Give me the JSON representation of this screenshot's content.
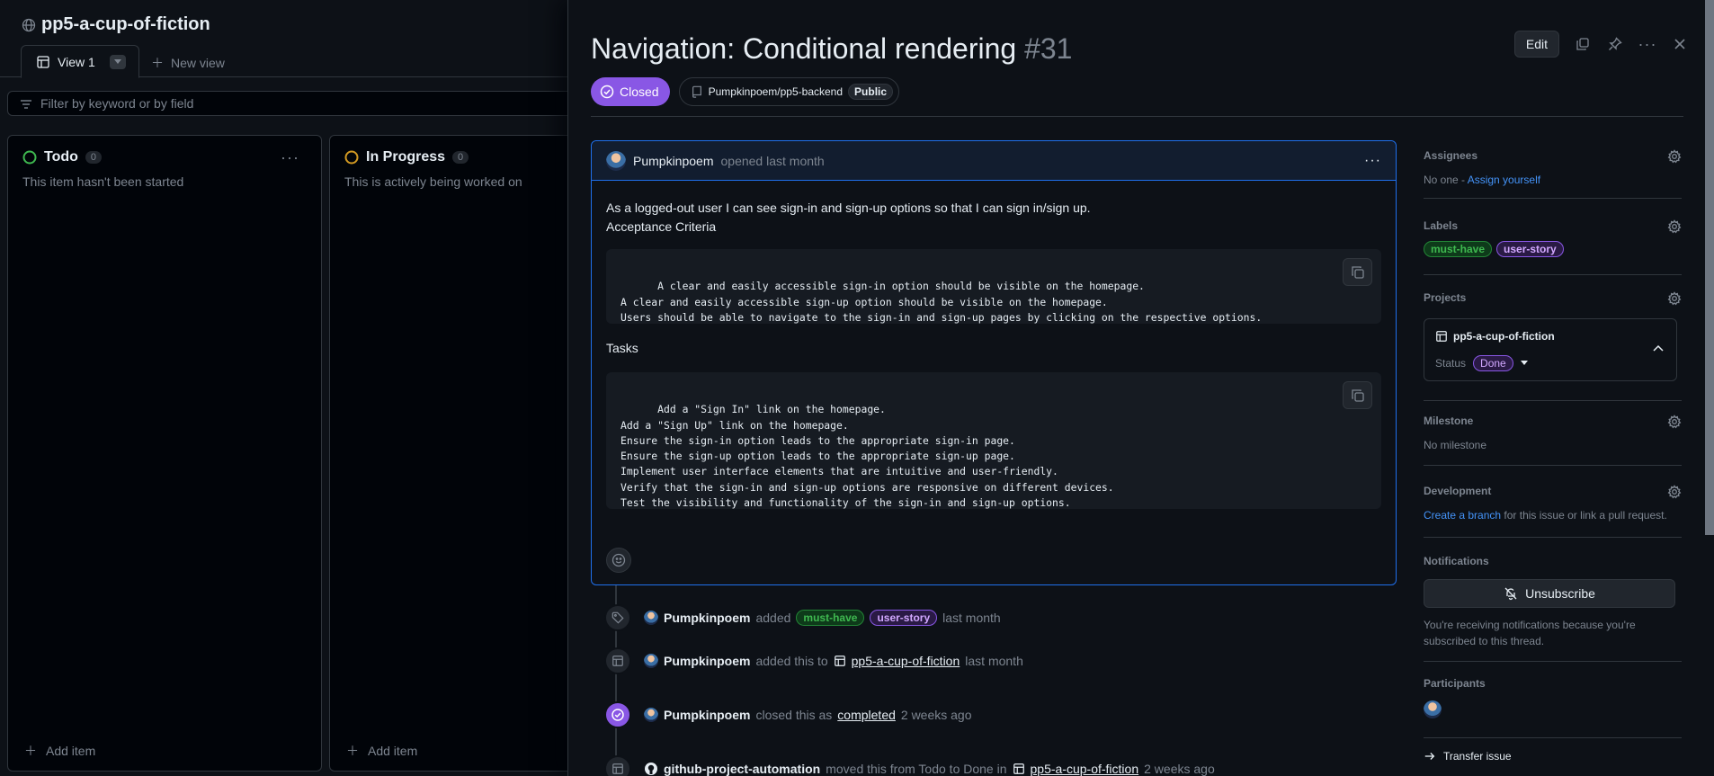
{
  "board": {
    "title": "pp5-a-cup-of-fiction",
    "view_tab": "View 1",
    "new_view": "New view",
    "filter_placeholder": "Filter by keyword or by field",
    "columns": [
      {
        "name": "Todo",
        "count": "0",
        "description": "This item hasn't been started",
        "add": "Add item",
        "status_color": "#3fb950"
      },
      {
        "name": "In Progress",
        "count": "0",
        "description": "This is actively being worked on",
        "add": "Add item",
        "status_color": "#d29922"
      }
    ]
  },
  "issue": {
    "title": "Navigation: Conditional rendering",
    "number": "#31",
    "edit_label": "Edit",
    "state": "Closed",
    "repo": "Pumpkinpoem/pp5-backend",
    "visibility": "Public",
    "comment": {
      "author": "Pumpkinpoem",
      "meta": "opened last month",
      "line1": "As a logged-out user I can see sign-in and sign-up options so that I can sign in/sign up.",
      "line2": "Acceptance Criteria",
      "code1": "A clear and easily accessible sign-in option should be visible on the homepage.\nA clear and easily accessible sign-up option should be visible on the homepage.\nUsers should be able to navigate to the sign-in and sign-up pages by clicking on the respective options.",
      "tasks_heading": "Tasks",
      "code2": "Add a \"Sign In\" link on the homepage.\nAdd a \"Sign Up\" link on the homepage.\nEnsure the sign-in option leads to the appropriate sign-in page.\nEnsure the sign-up option leads to the appropriate sign-up page.\nImplement user interface elements that are intuitive and user-friendly.\nVerify that the sign-in and sign-up options are responsive on different devices.\nTest the visibility and functionality of the sign-in and sign-up options."
    },
    "timeline": [
      {
        "actor": "Pumpkinpoem",
        "action": "added",
        "labels": [
          "must-have",
          "user-story"
        ],
        "time": "last month"
      },
      {
        "actor": "Pumpkinpoem",
        "action": "added this to",
        "project": "pp5-a-cup-of-fiction",
        "time": "last month"
      },
      {
        "actor": "Pumpkinpoem",
        "action": "closed this as",
        "link": "completed",
        "time": "2 weeks ago"
      },
      {
        "actor": "github-project-automation",
        "action": "moved this from Todo to Done in",
        "project": "pp5-a-cup-of-fiction",
        "time": "2 weeks ago"
      }
    ]
  },
  "sidebar": {
    "assignees": {
      "title": "Assignees",
      "value": "No one - ",
      "link": "Assign yourself"
    },
    "labels": {
      "title": "Labels",
      "items": [
        "must-have",
        "user-story"
      ]
    },
    "projects": {
      "title": "Projects",
      "name": "pp5-a-cup-of-fiction",
      "status_label": "Status",
      "status": "Done"
    },
    "milestone": {
      "title": "Milestone",
      "value": "No milestone"
    },
    "development": {
      "title": "Development",
      "link": "Create a branch",
      "rest": " for this issue or link a pull request."
    },
    "notifications": {
      "title": "Notifications",
      "button": "Unsubscribe",
      "note": "You're receiving notifications because you're subscribed to this thread."
    },
    "participants": {
      "title": "Participants"
    },
    "transfer": "Transfer issue"
  },
  "colors": {
    "accent": "#1f6feb",
    "closed": "#8957e5",
    "link": "#4493f8"
  }
}
